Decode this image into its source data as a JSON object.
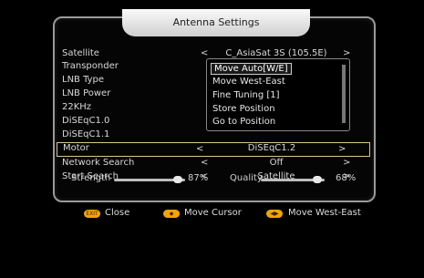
{
  "window": {
    "title": "Antenna Settings"
  },
  "rows": [
    {
      "label": "Satellite",
      "value": "C_AsiaSat 3S (105.5E)",
      "left_arrow": "<",
      "right_arrow": ">"
    },
    {
      "label": "Transponder"
    },
    {
      "label": "LNB Type"
    },
    {
      "label": "LNB Power"
    },
    {
      "label": "22KHz"
    },
    {
      "label": "DiSEqC1.0"
    },
    {
      "label": "DiSEqC1.1"
    },
    {
      "label": "Motor",
      "value": "DiSEqC1.2",
      "left_arrow": "<",
      "right_arrow": ">"
    },
    {
      "label": "Network Search",
      "value": "Off",
      "left_arrow": "<",
      "right_arrow": ">"
    },
    {
      "label": "Start Search",
      "value": "Satellite",
      "left_arrow": "<",
      "right_arrow": ">"
    }
  ],
  "dropdown": {
    "items": [
      "Move Auto[W/E]",
      "Move West-East",
      "Fine Tuning [1]",
      "Store Position",
      "Go to Position"
    ],
    "selected_index": 0
  },
  "signal": {
    "strength_label": "Strength",
    "strength_value": "87%",
    "strength_level": 0.87,
    "quality_label": "Quality",
    "quality_value": "68%",
    "quality_level": 0.68
  },
  "legend": [
    {
      "badge": "EXIT",
      "label": "Close",
      "icon": "exit-key-icon"
    },
    {
      "badge": "◆",
      "label": "Move Cursor",
      "icon": "updown-key-icon"
    },
    {
      "badge": "◀▶",
      "label": "Move West-East",
      "icon": "leftright-key-icon"
    }
  ],
  "colors": {
    "accent": "#f3a500",
    "selection_border": "#d9c48c"
  }
}
